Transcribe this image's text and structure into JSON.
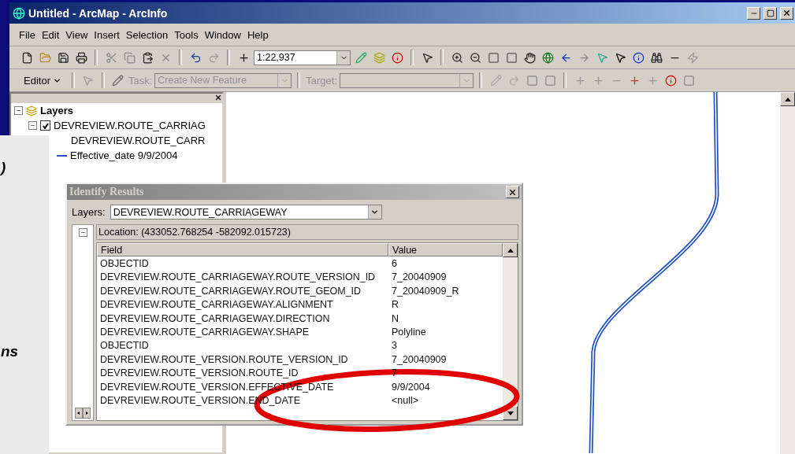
{
  "window": {
    "title": "Untitled - ArcMap - ArcInfo"
  },
  "menu": [
    "File",
    "Edit",
    "View",
    "Insert",
    "Selection",
    "Tools",
    "Window",
    "Help"
  ],
  "toolbar": {
    "scale": "1:22,937"
  },
  "editor_toolbar": {
    "editor": "Editor",
    "task_label": "Task:",
    "task": "Create New Feature",
    "target_label": "Target:"
  },
  "toc": {
    "title": "Layers",
    "expanded": true,
    "layers": [
      {
        "name": "DEVREVIEW.ROUTE_CARRIAG",
        "checked": true,
        "expanded": true,
        "legend_heading": "DEVREVIEW.ROUTE_CARR",
        "legend": [
          {
            "label": "Effective_date 9/9/2004",
            "color": "#2255cc"
          }
        ]
      }
    ]
  },
  "slide_text": [
    ")",
    "ns"
  ],
  "identify": {
    "title": "Identify Results",
    "layers_label": "Layers:",
    "layer": "DEVREVIEW.ROUTE_CARRIAGEWAY",
    "location": "Location: (433052.768254 -582092.015723)",
    "columns": [
      "Field",
      "Value"
    ],
    "rows": [
      {
        "field": "OBJECTID",
        "value": "6"
      },
      {
        "field": "DEVREVIEW.ROUTE_CARRIAGEWAY.ROUTE_VERSION_ID",
        "value": "7_20040909"
      },
      {
        "field": "DEVREVIEW.ROUTE_CARRIAGEWAY.ROUTE_GEOM_ID",
        "value": "7_20040909_R"
      },
      {
        "field": "DEVREVIEW.ROUTE_CARRIAGEWAY.ALIGNMENT",
        "value": "R"
      },
      {
        "field": "DEVREVIEW.ROUTE_CARRIAGEWAY.DIRECTION",
        "value": "N"
      },
      {
        "field": "DEVREVIEW.ROUTE_CARRIAGEWAY.SHAPE",
        "value": "Polyline"
      },
      {
        "field": "OBJECTID",
        "value": "3"
      },
      {
        "field": "DEVREVIEW.ROUTE_VERSION.ROUTE_VERSION_ID",
        "value": "7_20040909"
      },
      {
        "field": "DEVREVIEW.ROUTE_VERSION.ROUTE_ID",
        "value": "7"
      },
      {
        "field": "DEVREVIEW.ROUTE_VERSION.EFFECTIVE_DATE",
        "value": "9/9/2004"
      },
      {
        "field": "DEVREVIEW.ROUTE_VERSION.END_DATE",
        "value": "<null>"
      }
    ]
  }
}
